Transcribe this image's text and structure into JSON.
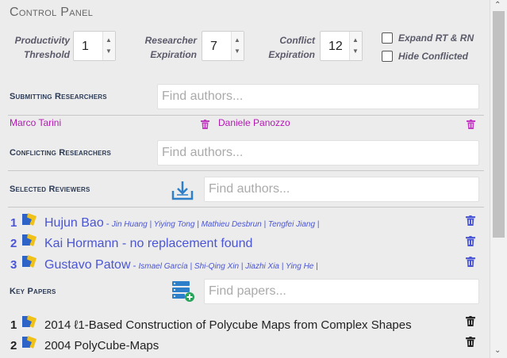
{
  "panel": {
    "title": "Control Panel"
  },
  "params": {
    "productivity": {
      "label_line1": "Productivity",
      "label_line2": "Threshold",
      "value": "1"
    },
    "expiration": {
      "label_line1": "Researcher",
      "label_line2": "Expiration",
      "value": "7"
    },
    "conflict": {
      "label_line1": "Conflict",
      "label_line2": "Expiration",
      "value": "12"
    }
  },
  "options": {
    "expand": {
      "label": "Expand RT & RN",
      "checked": false
    },
    "hide": {
      "label": "Hide Conflicted",
      "checked": false
    }
  },
  "submitting": {
    "label": "Submitting Researchers",
    "placeholder": "Find authors...",
    "researchers": [
      "Marco Tarini",
      "Daniele Panozzo"
    ]
  },
  "conflicting": {
    "label": "Conflicting Researchers",
    "placeholder": "Find authors..."
  },
  "reviewers": {
    "label": "Selected Reviewers",
    "placeholder": "Find authors...",
    "items": [
      {
        "num": "1",
        "name": "Hujun Bao",
        "dash": "-",
        "coauthors": "Jin Huang | Yiying Tong | Mathieu Desbrun | Tengfei Jiang |"
      },
      {
        "num": "2",
        "name": "Kai Hormann - no replacement found",
        "dash": "",
        "coauthors": ""
      },
      {
        "num": "3",
        "name": "Gustavo Patow",
        "dash": "-",
        "coauthors": "Ismael García | Shi-Qing Xin | Jiazhi Xia | Ying He |"
      }
    ]
  },
  "papers": {
    "label": "Key Papers",
    "placeholder": "Find papers...",
    "items": [
      {
        "num": "1",
        "title": "2014 ℓ1-Based Construction of Polycube Maps from Complex Shapes"
      },
      {
        "num": "2",
        "title": "2004 PolyCube-Maps"
      }
    ]
  },
  "colors": {
    "accent": "#4a55d6",
    "researcher": "#b21ab2",
    "heading": "#2b3a55"
  },
  "icons": {
    "spinner_up": "▲",
    "spinner_down": "▼",
    "scroll_up": "⌃",
    "scroll_down": "⌄"
  }
}
